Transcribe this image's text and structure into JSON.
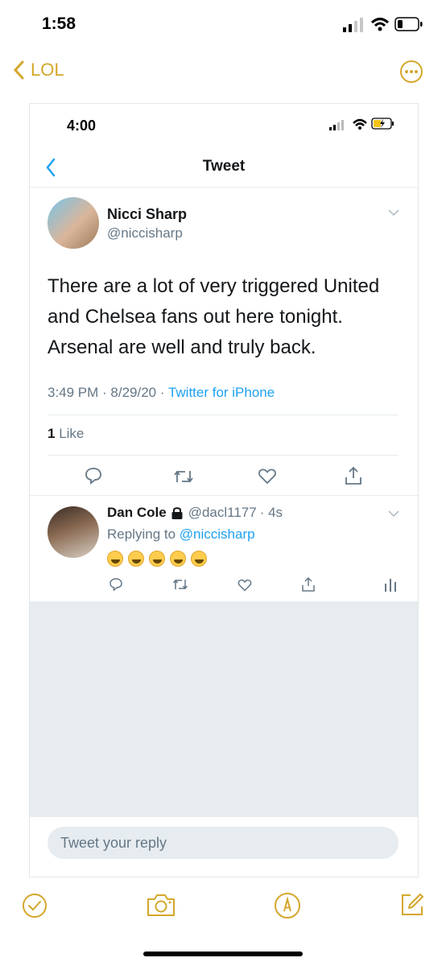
{
  "status_bar": {
    "time": "1:58"
  },
  "notes_nav": {
    "back_label": "LOL"
  },
  "screenshot": {
    "status_time": "4:00",
    "header_title": "Tweet",
    "tweet": {
      "author_name": "Nicci Sharp",
      "author_handle": "@niccisharp",
      "text_lines": [
        "There are a lot of very triggered United",
        "and Chelsea fans out here tonight.",
        "Arsenal are well and truly back."
      ],
      "timestamp": "3:49 PM · 8/29/20 · ",
      "source": "Twitter for iPhone",
      "like_count": "1",
      "like_label": "Like"
    },
    "reply": {
      "author_name": "Dan Cole",
      "author_handle": "@dacl1177",
      "age": "· 4s",
      "replying_prefix": "Replying to ",
      "replying_handle": "@niccisharp",
      "emoji_count": 5
    },
    "reply_input_placeholder": "Tweet your reply"
  },
  "colors": {
    "accent": "#d4a72c",
    "twitter_blue": "#1da1f2",
    "gray_text": "#657786",
    "reply_bg": "#e6ecf0"
  },
  "icons": [
    "chevron-left-icon",
    "more-icon",
    "reply-icon",
    "retweet-icon",
    "like-icon",
    "share-icon",
    "analytics-icon",
    "checkmark-circle-icon",
    "camera-icon",
    "markup-icon",
    "compose-icon"
  ]
}
